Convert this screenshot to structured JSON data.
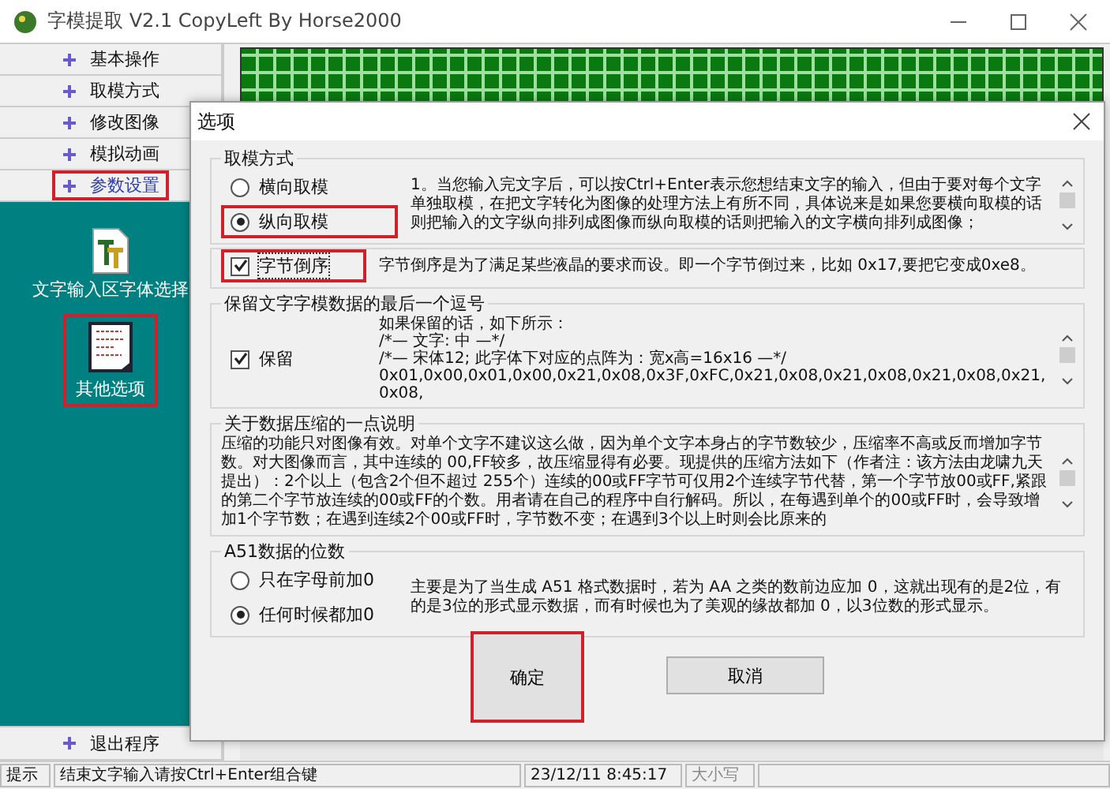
{
  "window": {
    "title": "字模提取 V2.1  CopyLeft By Horse2000"
  },
  "nav": {
    "items": [
      {
        "label": "基本操作",
        "selected": false,
        "highlighted": false
      },
      {
        "label": "取模方式",
        "selected": false,
        "highlighted": false
      },
      {
        "label": "修改图像",
        "selected": false,
        "highlighted": false
      },
      {
        "label": "模拟动画",
        "selected": false,
        "highlighted": false
      },
      {
        "label": "参数设置",
        "selected": true,
        "highlighted": true
      }
    ]
  },
  "tools": [
    {
      "kind": "font",
      "label": "文字输入区字体选择",
      "highlighted": false
    },
    {
      "kind": "document",
      "label": "其他选项",
      "highlighted": true
    }
  ],
  "exit_item": {
    "label": "退出程序"
  },
  "dialog": {
    "title": "选项",
    "groups": [
      {
        "kind": "radio",
        "title": "取模方式",
        "options": [
          {
            "label": "横向取模",
            "selected": false,
            "highlighted": false
          },
          {
            "label": "纵向取模",
            "selected": true,
            "highlighted": true
          }
        ],
        "text": "1。当您输入完文字后，可以按Ctrl+Enter表示您想结束文字的输入，但由于要对每个文字单独取模，在把文字转化为图像的处理方法上有所不同，具体说来是如果您要横向取模的话则把输入的文字纵向排列成图像而纵向取模的话则把输入的文字横向排列成图像；",
        "scroll": true
      },
      {
        "kind": "check",
        "check": {
          "label": "字节倒序",
          "checked": true,
          "highlighted": true
        },
        "text": "字节倒序是为了满足某些液晶的要求而设。即一个字节倒过来，比如 0x17,要把它变成0xe8。",
        "scroll": false
      },
      {
        "kind": "check",
        "title": "保留文字字模数据的最后一个逗号",
        "check": {
          "label": "保留",
          "checked": true,
          "highlighted": false
        },
        "lines": [
          "如果保留的话，如下所示：",
          "/*—  文字:  中  —*/",
          "/*—  宋体12;  此字体下对应的点阵为：宽x高=16x16   —*/",
          "0x01,0x00,0x01,0x00,0x21,0x08,0x3F,0xFC,0x21,0x08,0x21,0x08,0x21,0x08,0x21,0x08,"
        ],
        "scroll": true
      },
      {
        "kind": "note",
        "title": "关于数据压缩的一点说明",
        "text": "压缩的功能只对图像有效。对单个文字不建议这么做，因为单个文字本身占的字节数较少，压缩率不高或反而增加字节数。对大图像而言，其中连续的 00,FF较多，故压缩显得有必要。现提供的压缩方法如下（作者注：该方法由龙啸九天提出）：2个以上（包含2个但不超过 255个）连续的00或FF字节可仅用2个连续字节代替，第一个字节放00或FF,紧跟的第二个字节放连续的00或FF的个数。用者请在自己的程序中自行解码。所以，在每遇到单个的00或FF时，会导致增加1个字节数；在遇到连续2个00或FF时，字节数不变；在遇到3个以上时则会比原来的",
        "scroll": true
      },
      {
        "kind": "radio",
        "title": "A51数据的位数",
        "options": [
          {
            "label": "只在字母前加0",
            "selected": false,
            "highlighted": false
          },
          {
            "label": "任何时候都加0",
            "selected": true,
            "highlighted": false
          }
        ],
        "text": "主要是为了当生成 A51 格式数据时，若为 AA 之类的数前边应加 0，这就出现有的是2位，有的是3位的形式显示数据，而有时候也为了美观的缘故都加 0，以3位数的形式显示。",
        "scroll": false
      }
    ],
    "buttons": [
      {
        "label": "确定",
        "highlighted": true
      },
      {
        "label": "取消",
        "highlighted": false
      }
    ]
  },
  "status_bar": {
    "label": "提示",
    "message": "结束文字输入请按Ctrl+Enter组合键",
    "time": "23/12/11 8:45:17",
    "caps": "大小写"
  }
}
